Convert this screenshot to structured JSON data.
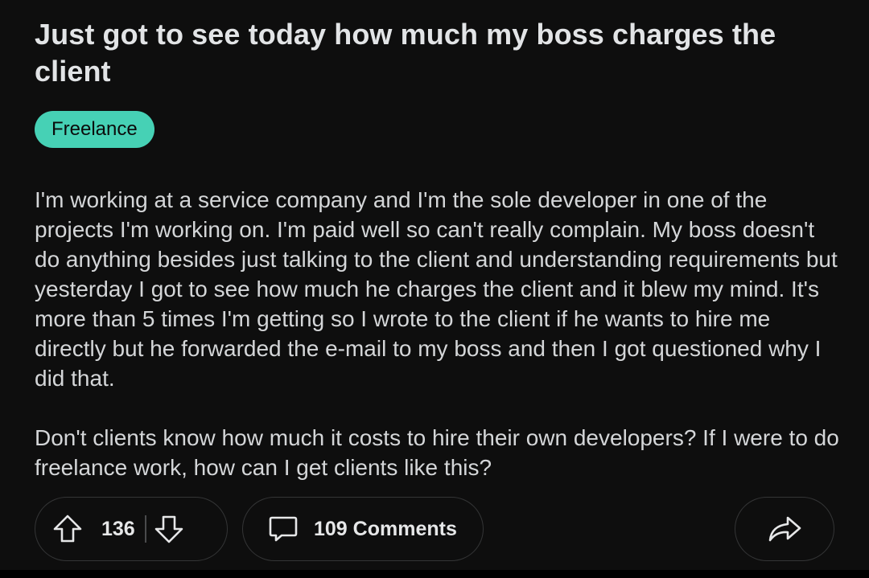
{
  "post": {
    "title": "Just got to see today how much my boss charges the client",
    "flair": "Freelance",
    "body": [
      "I'm working at a service company and I'm the sole developer in one of the projects I'm working on. I'm paid well so can't really complain. My boss doesn't do anything besides just talking to the client and understanding requirements but yesterday I got to see how much he charges the client and it blew my mind. It's more than 5 times I'm getting so I wrote to the client if he wants to hire me directly but he forwarded the e-mail to my boss and then I got questioned why I did that.",
      "Don't clients know how much it costs to hire their own developers? If I were to do freelance work, how can I get clients like this?"
    ]
  },
  "actions": {
    "upvote_icon": "arrow-up-icon",
    "vote_count": "136",
    "downvote_icon": "arrow-down-icon",
    "comments_icon": "chat-bubble-icon",
    "comments_label": "109 Comments",
    "share_icon": "share-arrow-icon"
  },
  "colors": {
    "background": "#0e0e0e",
    "text": "#d7dadc",
    "flair_bg": "#46d1b5",
    "pill_border": "#343536"
  }
}
